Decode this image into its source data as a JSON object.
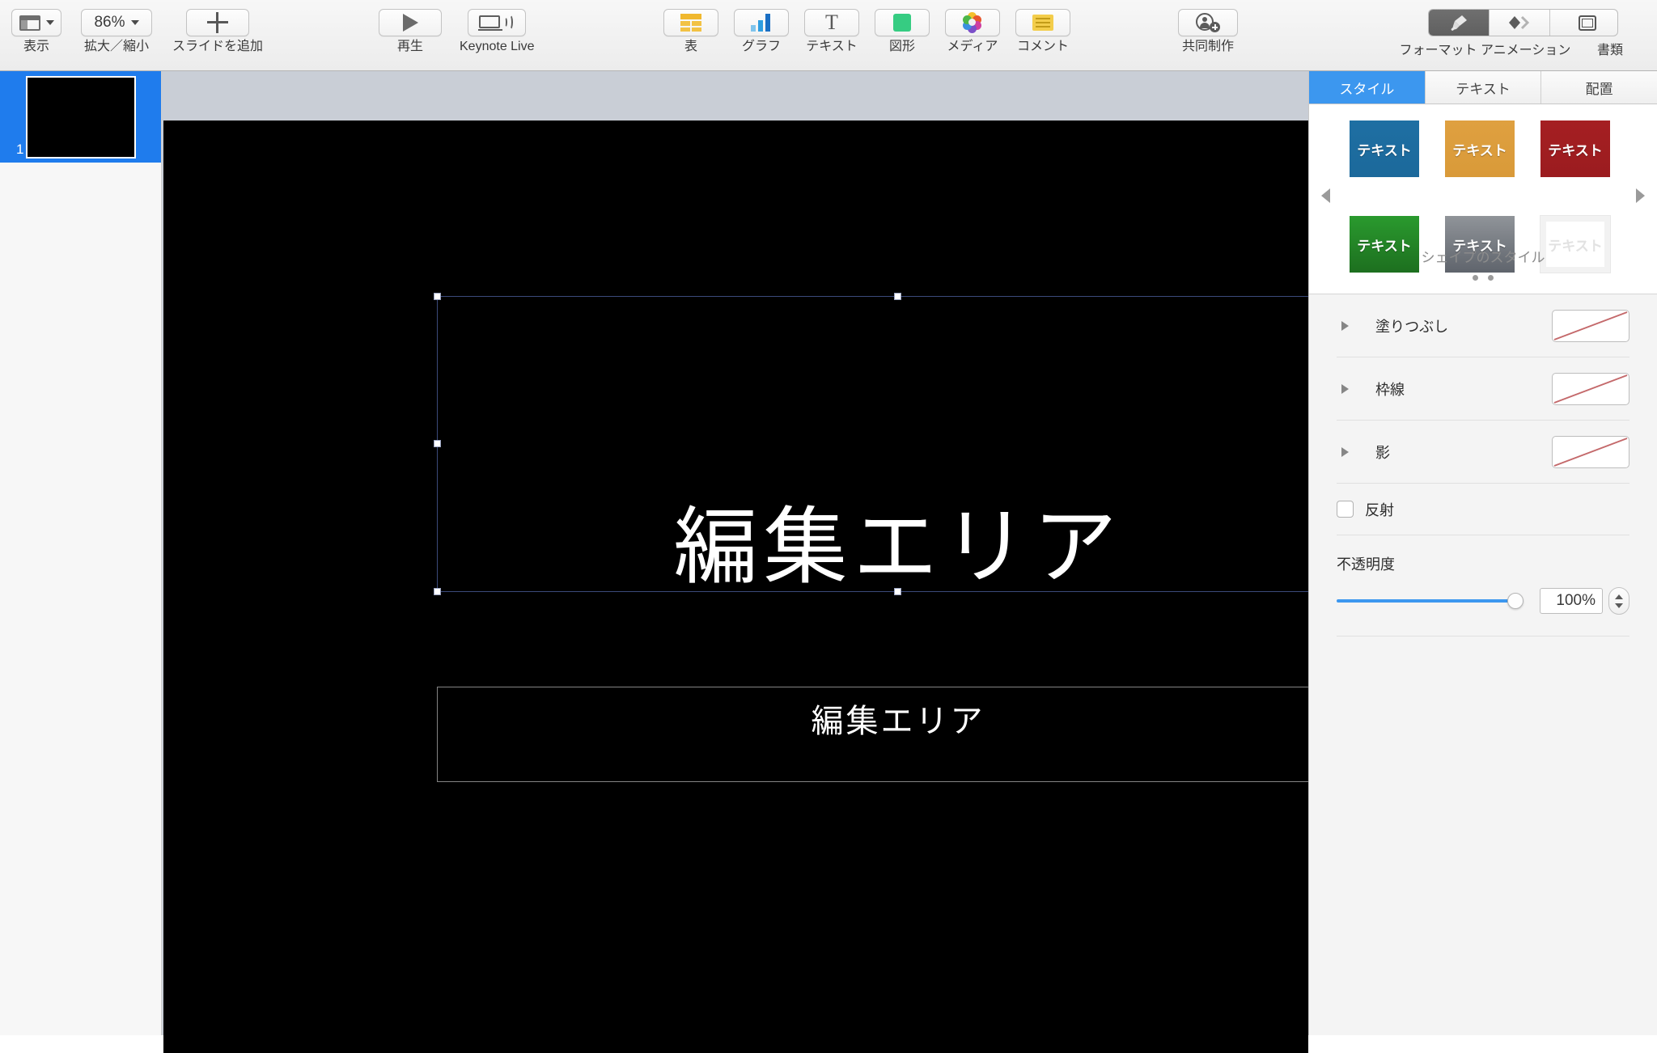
{
  "toolbar": {
    "view": {
      "label": "表示",
      "icon": "view-layout-icon"
    },
    "zoom": {
      "label": "拡大／縮小",
      "value": "86%",
      "icon": "chevron-down-icon"
    },
    "add_slide": {
      "label": "スライドを追加",
      "icon": "plus-icon"
    },
    "play": {
      "label": "再生",
      "icon": "play-icon"
    },
    "keynote_live": {
      "label": "Keynote Live",
      "icon": "display-broadcast-icon"
    },
    "table": {
      "label": "表",
      "icon": "table-icon"
    },
    "chart": {
      "label": "グラフ",
      "icon": "bar-chart-icon"
    },
    "text": {
      "label": "テキスト",
      "icon": "text-T-icon"
    },
    "shape": {
      "label": "図形",
      "icon": "shape-square-icon"
    },
    "media": {
      "label": "メディア",
      "icon": "photos-flower-icon"
    },
    "comment": {
      "label": "コメント",
      "icon": "comment-note-icon"
    },
    "collaborate": {
      "label": "共同制作",
      "icon": "add-person-icon"
    },
    "format": {
      "label": "フォーマット",
      "icon": "paintbrush-icon",
      "active": true
    },
    "animate": {
      "label": "アニメーション",
      "icon": "diamond-arrow-icon",
      "active": false
    },
    "document": {
      "label": "書類",
      "icon": "document-frame-icon",
      "active": false
    }
  },
  "navigator": {
    "slides": [
      {
        "number": "1",
        "selected": true
      }
    ]
  },
  "slide": {
    "background_color": "#000000",
    "title_textbox": {
      "text": "編集エリア",
      "selected": true,
      "text_color": "#FFFFFF",
      "selection_color": "#3B4A7A"
    },
    "body_textbox": {
      "text": "編集エリア",
      "selected": false,
      "text_color": "#FFFFFF",
      "border_color": "#848484"
    }
  },
  "inspector": {
    "tabs": [
      {
        "label": "スタイル",
        "active": true
      },
      {
        "label": "テキスト",
        "active": false
      },
      {
        "label": "配置",
        "active": false
      }
    ],
    "style_picker": {
      "caption": "シェイプのスタイル",
      "swatches": [
        {
          "label": "テキスト",
          "variant": "blue",
          "color": "#1E6FA3"
        },
        {
          "label": "テキスト",
          "variant": "amber",
          "color": "#DFA040"
        },
        {
          "label": "テキスト",
          "variant": "red",
          "color": "#A51F22"
        },
        {
          "label": "テキスト",
          "variant": "green",
          "color": "#2A9A2E"
        },
        {
          "label": "テキスト",
          "variant": "gray",
          "color": "#909499"
        },
        {
          "label": "テキスト",
          "variant": "outline",
          "color": "#FFFFFF"
        }
      ],
      "page_dots": 2,
      "prev_icon": "chevron-left-icon",
      "next_icon": "chevron-right-icon"
    },
    "rows": [
      {
        "label": "塗りつぶし",
        "value": "none",
        "disclosure": "disclosure-triangle-icon"
      },
      {
        "label": "枠線",
        "value": "none",
        "disclosure": "disclosure-triangle-icon"
      },
      {
        "label": "影",
        "value": "none",
        "disclosure": "disclosure-triangle-icon"
      }
    ],
    "reflection": {
      "label": "反射",
      "checked": false
    },
    "opacity": {
      "label": "不透明度",
      "value": "100%",
      "percent": 100
    }
  },
  "colors": {
    "accent": "#3C97EF",
    "selection_blue": "#1F7CED",
    "canvas_bg": "#C9CED6",
    "none_slash": "#C4696B"
  }
}
